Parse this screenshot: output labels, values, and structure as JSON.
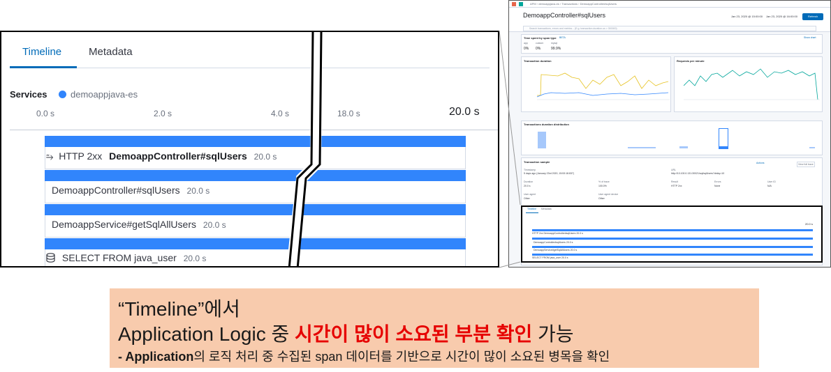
{
  "zoom": {
    "tabs": {
      "timeline": "Timeline",
      "metadata": "Metadata"
    },
    "services_label": "Services",
    "service_name": "demoappjava-es",
    "service_color": "#3185fc",
    "ticks": [
      "0.0 s",
      "2.0 s",
      "4.0 s",
      "18.0 s",
      "20.0 s"
    ],
    "rows": [
      {
        "prefix": "HTTP 2xx",
        "name": "DemoappController#sqlUsers",
        "duration": "20.0 s"
      },
      {
        "name": "DemoappController#sqlUsers",
        "duration": "20.0 s"
      },
      {
        "name": "DemoappService#getSqlAllUsers",
        "duration": "20.0 s"
      },
      {
        "name": "SELECT FROM java_user",
        "duration": "20.0 s"
      }
    ]
  },
  "thumb": {
    "breadcrumb": "APM  ›  demoappjava-es  ›  Transactions  ›  DemoappController#sqlUsers",
    "title": "DemoappController#sqlUsers",
    "date_start": "Jan 23, 2020 @ 15:00:00",
    "date_end": "Jan 23, 2020 @ 16:00:00",
    "refresh": "Refresh",
    "search_placeholder": "Search transactions, errors and metrics... (E.g. transaction.duration.us > 300000)",
    "time_spent": {
      "title": "Time spent by span type",
      "badge": "BETA",
      "show_chart": "Show chart",
      "legend": [
        "app",
        "custom",
        "mysql"
      ],
      "values": [
        "0%",
        "0%",
        "99.9%"
      ]
    },
    "transaction_duration_title": "Transaction duration",
    "requests_title": "Requests per minute",
    "distribution_title": "Transactions duration distribution",
    "sample": {
      "title": "Transaction sample",
      "actions": "Actions",
      "view_full_trace": "View full trace",
      "timestamp_label": "Timestamp",
      "timestamp": "5 days ago (January 23rd 2020, 15:53:18.837)",
      "url_label": "URL",
      "url": "http://10.100.0.131:30021/sql/sqlUsers?delay=10",
      "fields": [
        {
          "label": "Duration",
          "value": "20.0 s"
        },
        {
          "label": "% of trace",
          "value": "100.0%"
        },
        {
          "label": "Result",
          "value": "HTTP 2xx"
        },
        {
          "label": "Errors",
          "value": "None"
        },
        {
          "label": "User ID",
          "value": "N/A"
        }
      ],
      "fields2": [
        {
          "label": "User agent",
          "value": "Other"
        },
        {
          "label": "User agent device",
          "value": "Other"
        }
      ]
    },
    "mini_tabs": [
      "Timeline",
      "Metadata"
    ],
    "mini_rows": [
      "HTTP 2xx  DemoappController#sqlUsers  20.0 s",
      "DemoappController#sqlUsers  20.0 s",
      "DemoappService#getSqlAllUsers  20.0 s",
      "SELECT FROM java_user  20.0 s"
    ],
    "mini_total": "20.0 s"
  },
  "caption": {
    "line1": "“Timeline”에서",
    "line2_pre": "Application Logic 중 ",
    "line2_highlight": "시간이 많이 소요된 부분 확인",
    "line2_post": " 가능",
    "line3_prefix": "- Application",
    "line3_rest": "의 로직 처리 중 수집된 span 데이터를 기반으로 시간이 많이 소요된 병목을 확인",
    "highlight_color": "#e60000",
    "background_color": "#f8cbad"
  }
}
